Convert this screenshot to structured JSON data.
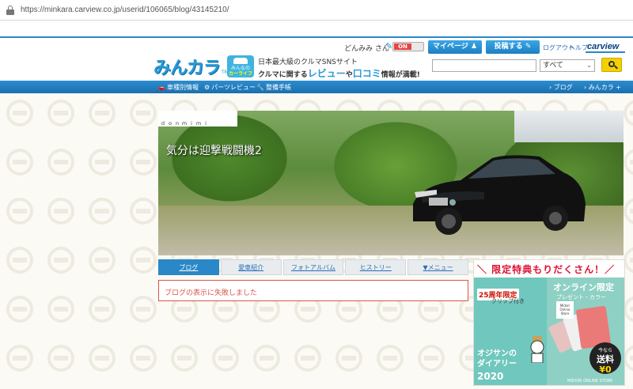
{
  "browser": {
    "url": "https://minkara.carview.co.jp/userid/106065/blog/43145210/"
  },
  "header": {
    "logo": "みんカラ",
    "logo_tm": "TM",
    "badge_line1": "みんなの",
    "badge_line2": "カーライフ",
    "tagline1": "日本最大級のクルマSNSサイト",
    "tagline2_pre": "クルマに関する",
    "tagline2_hl1": "レビュー",
    "tagline2_mid": "や",
    "tagline2_hl2": "口コミ",
    "tagline2_post": "情報が満載!",
    "user_name": "どんみみ さん",
    "toggle_label": "ON",
    "mypage_label": "マイページ",
    "post_label": "投稿する",
    "logout_label": "ログアウト",
    "help_label": "ヘルプ",
    "carview_logo": "carview",
    "search_scope": "すべて"
  },
  "nav": {
    "items": [
      {
        "label": "車種別情報",
        "icon": "car-icon"
      },
      {
        "label": "パーツレビュー",
        "icon": "gear-icon"
      },
      {
        "label": "整備手帳",
        "icon": "wrench-icon"
      }
    ],
    "right_items": [
      {
        "label": "› ブログ"
      },
      {
        "label": "› みんカラ +"
      }
    ]
  },
  "hero": {
    "strip_label": "ｄｏｎｍｉｍｉ",
    "title": "気分は迎撃戦闘機2"
  },
  "tabs": [
    {
      "label": "ブログ",
      "active": true
    },
    {
      "label": "愛車紹介",
      "active": false
    },
    {
      "label": "フォトアルバム",
      "active": false
    },
    {
      "label": "ヒストリー",
      "active": false
    },
    {
      "label": "▼メニュー",
      "active": false
    }
  ],
  "error": {
    "message": "ブログの表示に失敗しました"
  },
  "ad": {
    "title": "＼ 限定特典もりだくさん！／",
    "anniv": "25周年限定",
    "clip": "クリップ付き",
    "online": "オンライン限定",
    "present": "プレゼント・カラー",
    "store_tag": "Midori Online Store",
    "diary_line1": "オジサンの",
    "diary_line2": "ダイアリー",
    "year": "2020",
    "price_now": "今なら",
    "price_big": "送料",
    "price_yen": "¥0",
    "footer": "MIDORI ONLINE STORE",
    "colors": {
      "left": "#6fc7bd",
      "right": "#8fd0c4",
      "title": "#dd1133"
    }
  },
  "colors": {
    "brand_blue": "#2a87c8",
    "error_red": "#d9564a",
    "search_yellow": "#f3d100"
  }
}
